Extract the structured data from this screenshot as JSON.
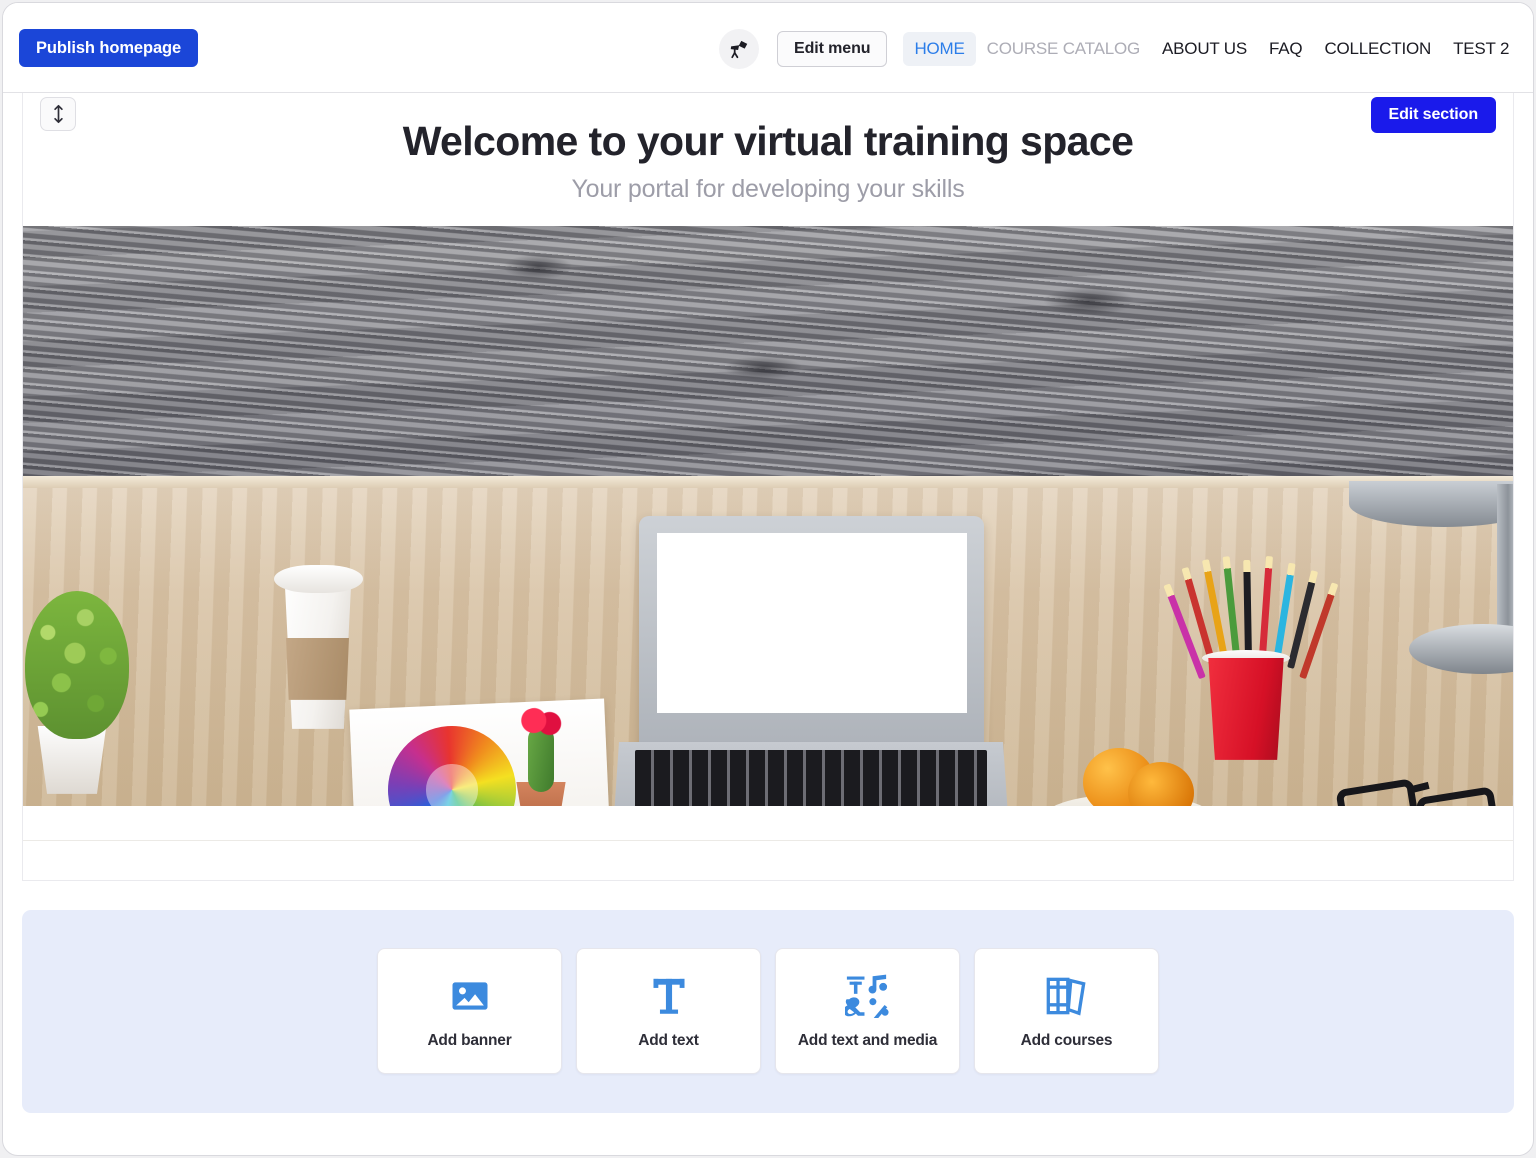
{
  "topbar": {
    "publish_label": "Publish homepage",
    "telescope_icon": "telescope-icon",
    "edit_menu_label": "Edit menu",
    "nav_items": [
      {
        "label": "HOME",
        "state": "active"
      },
      {
        "label": "COURSE CATALOG",
        "state": "muted"
      },
      {
        "label": "ABOUT US",
        "state": "normal"
      },
      {
        "label": "FAQ",
        "state": "normal"
      },
      {
        "label": "COLLECTION",
        "state": "normal"
      },
      {
        "label": "TEST 2",
        "state": "normal"
      }
    ]
  },
  "hero": {
    "drag_handle_icon": "vertical-resize-icon",
    "title": "Welcome to your virtual training space",
    "subtitle": "Your portal for developing your skills",
    "edit_section_label": "Edit section",
    "image_alt": "Desk with laptop, coffee cup, plant, color wheel, cactus, pencils, glasses, notebooks and lamp"
  },
  "add_panel": {
    "cards": [
      {
        "label": "Add banner",
        "icon": "image-icon"
      },
      {
        "label": "Add text",
        "icon": "text-t-icon"
      },
      {
        "label": "Add text and media",
        "icon": "text-and-media-icon"
      },
      {
        "label": "Add courses",
        "icon": "books-icon"
      }
    ]
  },
  "colors": {
    "publish_blue": "#1b46d8",
    "edit_section_blue": "#1a1aeb",
    "nav_active_blue": "#2b7de9",
    "panel_bg": "#e7ecfa",
    "card_icon_blue": "#3c8ade"
  }
}
